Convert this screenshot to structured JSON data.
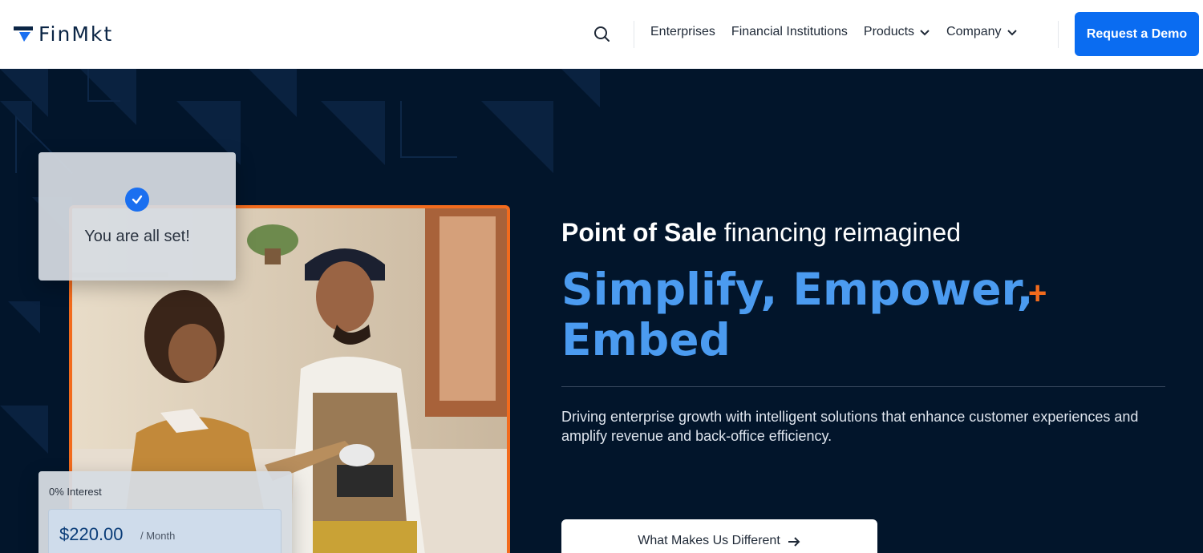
{
  "header": {
    "logo_text": "FinMkt",
    "nav": [
      {
        "label": "Enterprises"
      },
      {
        "label": "Financial Institutions"
      },
      {
        "label": "Products"
      },
      {
        "label": "Company"
      }
    ],
    "cta_label": "Request a Demo",
    "icons": {
      "search": "search-icon",
      "chevron": "chevron-down-icon"
    }
  },
  "hero": {
    "card_set": {
      "text": "You are all set!",
      "icon": "check-icon"
    },
    "card_interest": {
      "label": "0% Interest",
      "price": "$220.00",
      "period": "/ Month"
    },
    "kicker_bold": "Point of Sale",
    "kicker_rest": " financing reimagined",
    "headline_line1": "Simplify, Empower,",
    "headline_plus": "+",
    "headline_line2": "Embed",
    "description": "Driving enterprise growth with intelligent solutions that enhance customer experiences and amplify revenue and back-office efficiency.",
    "button_label": "What Makes Us Different",
    "button_icon": "arrow-right-icon"
  },
  "colors": {
    "brand_blue": "#0a6cf1",
    "hero_bg": "#02152b",
    "accent_orange": "#f26b1d",
    "headline_blue": "#4b9bf0"
  }
}
